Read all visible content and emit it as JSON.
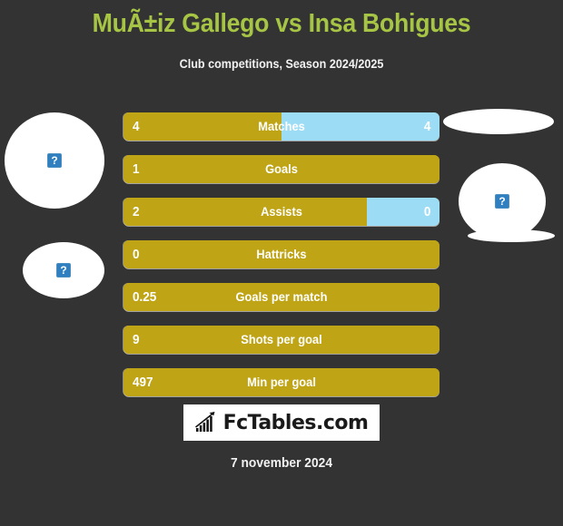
{
  "header": {
    "title": "MuÃ±iz Gallego vs Insa Bohigues",
    "subtitle": "Club competitions, Season 2024/2025",
    "title_color": "#a7c544"
  },
  "colors": {
    "background": "#333333",
    "home_bar": "#bfa415",
    "away_bar": "#9ddcf5",
    "text": "#ffffff"
  },
  "avatars": {
    "placeholder_glyph": "?",
    "home_label": "home-player-photo",
    "away_label": "away-player-photo"
  },
  "chart_data": {
    "type": "bar",
    "title": "MuÃ±iz Gallego vs Insa Bohigues",
    "subtitle": "Club competitions, Season 2024/2025",
    "orientation": "horizontal",
    "layout": "diverging-paired",
    "series": [
      {
        "name": "MuÃ±iz Gallego",
        "side": "left",
        "color": "#bfa415"
      },
      {
        "name": "Insa Bohigues",
        "side": "right",
        "color": "#9ddcf5"
      }
    ],
    "categories": [
      "Matches",
      "Goals",
      "Assists",
      "Hattricks",
      "Goals per match",
      "Shots per goal",
      "Min per goal"
    ],
    "rows": [
      {
        "label": "Matches",
        "home": "4",
        "away": "4",
        "home_pct": 50,
        "away_pct": 50
      },
      {
        "label": "Goals",
        "home": "1",
        "away": "",
        "home_pct": 100,
        "away_pct": 0
      },
      {
        "label": "Assists",
        "home": "2",
        "away": "0",
        "home_pct": 77,
        "away_pct": 23
      },
      {
        "label": "Hattricks",
        "home": "0",
        "away": "",
        "home_pct": 100,
        "away_pct": 0
      },
      {
        "label": "Goals per match",
        "home": "0.25",
        "away": "",
        "home_pct": 100,
        "away_pct": 0
      },
      {
        "label": "Shots per goal",
        "home": "9",
        "away": "",
        "home_pct": 100,
        "away_pct": 0
      },
      {
        "label": "Min per goal",
        "home": "497",
        "away": "",
        "home_pct": 100,
        "away_pct": 0
      }
    ]
  },
  "footer": {
    "logo_text": "FcTables.com",
    "logo_icon": "bar-chart-arrow-icon",
    "date": "7 november 2024"
  }
}
